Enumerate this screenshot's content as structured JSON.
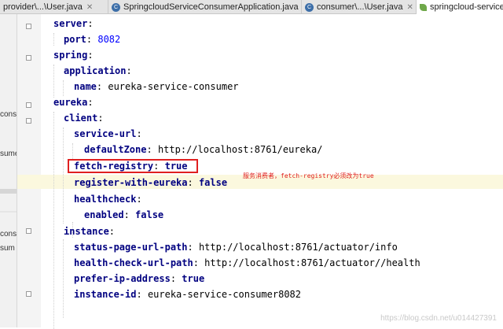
{
  "tabs": [
    {
      "label": "provider\\...\\User.java",
      "icon": "class-icon"
    },
    {
      "label": "SpringcloudServiceConsumerApplication.java",
      "icon": "class-icon"
    },
    {
      "label": "consumer\\...\\User.java",
      "icon": "class-icon"
    },
    {
      "label": "springcloud-service",
      "icon": "spring-leaf-icon"
    }
  ],
  "left_panel": {
    "items": [
      "cons",
      "sume",
      "cons",
      "sum"
    ]
  },
  "yaml": [
    {
      "key": "server",
      "sep": ":",
      "value": ""
    },
    {
      "key": "port",
      "sep": ": ",
      "value": "8082"
    },
    {
      "key": "spring",
      "sep": ":",
      "value": ""
    },
    {
      "key": "application",
      "sep": ":",
      "value": ""
    },
    {
      "key": "name",
      "sep": ": ",
      "value": "eureka-service-consumer"
    },
    {
      "key": "eureka",
      "sep": ":",
      "value": ""
    },
    {
      "key": "client",
      "sep": ":",
      "value": ""
    },
    {
      "key": "service-url",
      "sep": ":",
      "value": ""
    },
    {
      "key": "defaultZone",
      "sep": ": ",
      "value": "http://localhost:8761/eureka/"
    },
    {
      "key": "fetch-registry",
      "sep": ": ",
      "value": "true"
    },
    {
      "key": "register-with-eureka",
      "sep": ": ",
      "value": "false"
    },
    {
      "key": "healthcheck",
      "sep": ":",
      "value": ""
    },
    {
      "key": "enabled",
      "sep": ": ",
      "value": "false"
    },
    {
      "key": "instance",
      "sep": ":",
      "value": ""
    },
    {
      "key": "status-page-url-path",
      "sep": ": ",
      "value": "http://localhost:8761/actuator/info"
    },
    {
      "key": "health-check-url-path",
      "sep": ": ",
      "value": "http://localhost:8761/actuator//health"
    },
    {
      "key": "prefer-ip-address",
      "sep": ": ",
      "value": "true"
    },
    {
      "key": "instance-id",
      "sep": ": ",
      "value": "eureka-service-consumer8082"
    }
  ],
  "annotation": "服务消费者，fetch-registry必须改为true",
  "watermark": "https://blog.csdn.net/u014427391",
  "colors": {
    "key": "#000080",
    "number": "#0000ff",
    "highlight_box": "#e02020",
    "current_line": "#fbf8de"
  }
}
